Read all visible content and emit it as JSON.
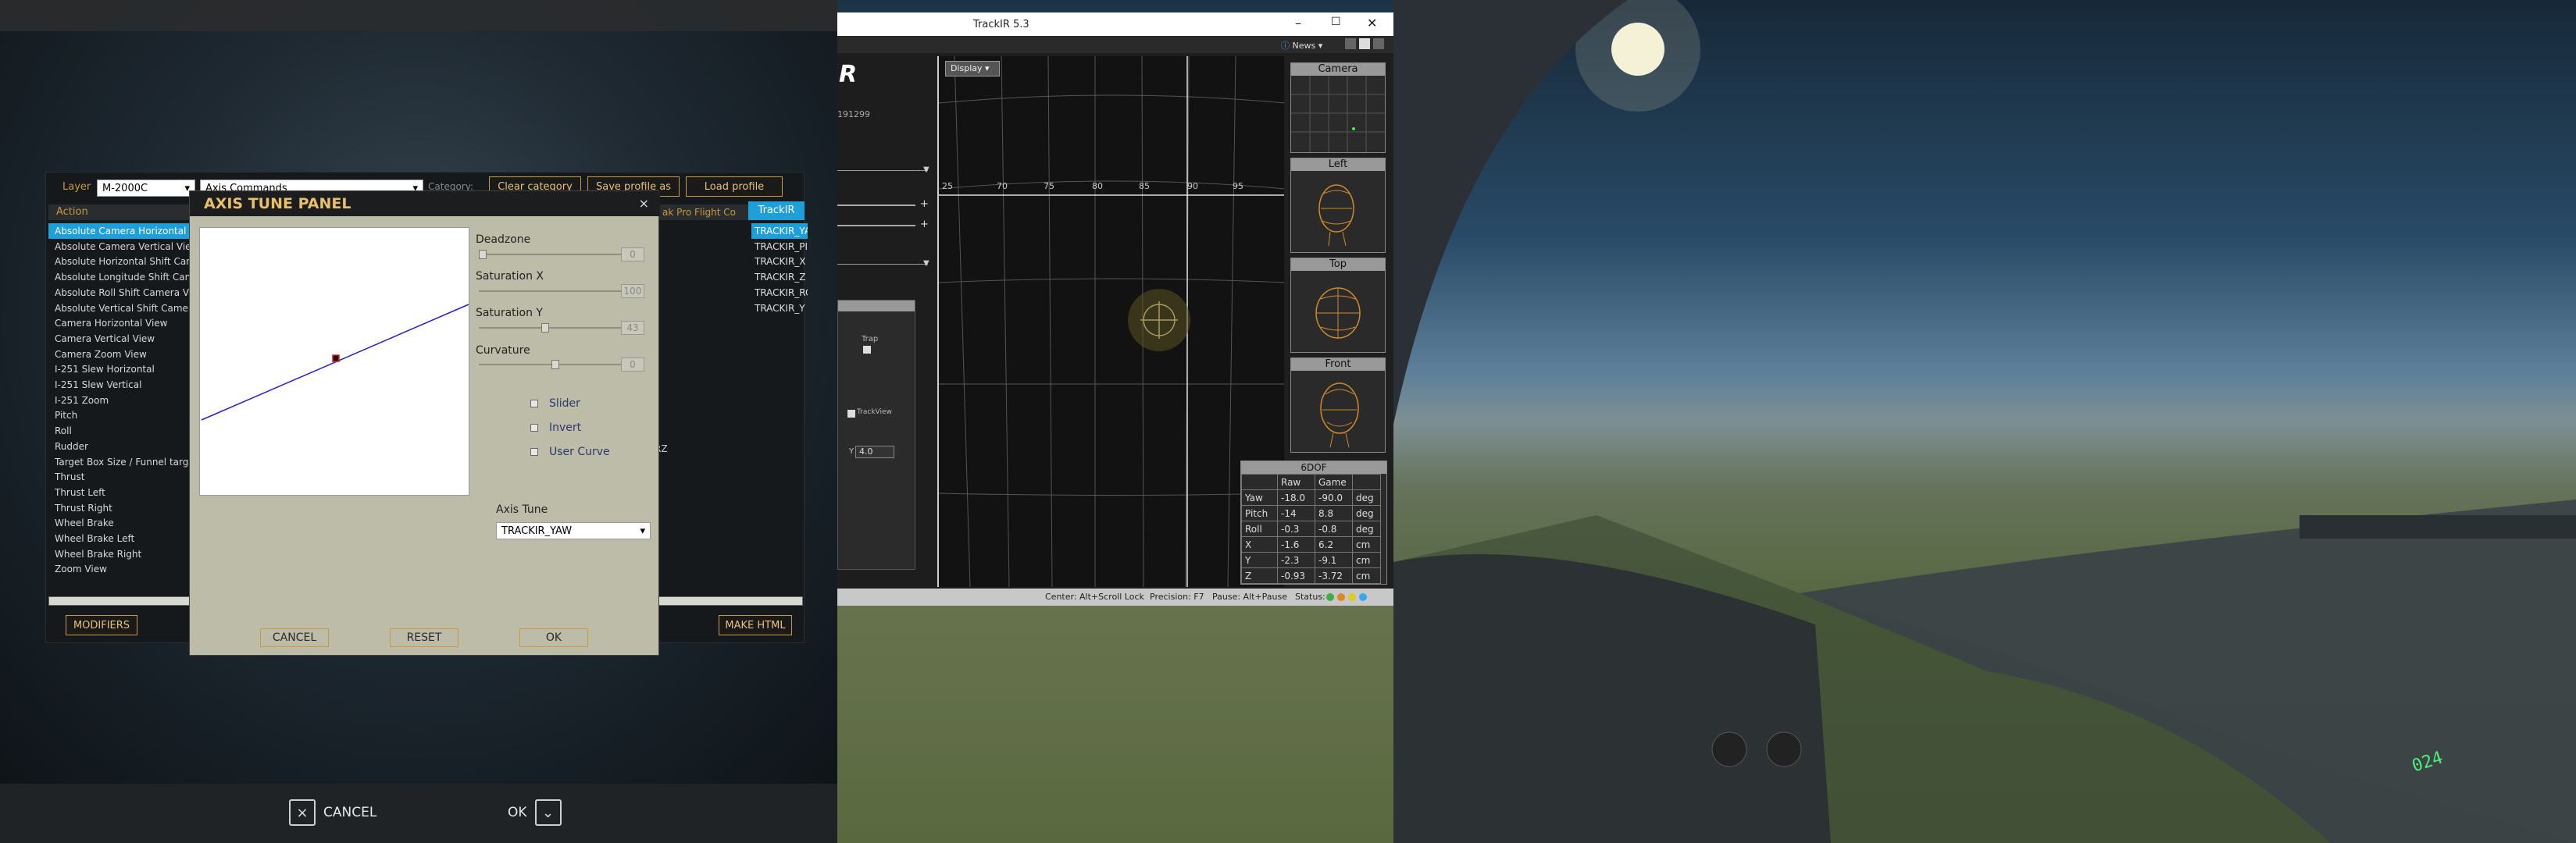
{
  "dcs": {
    "bottom_cancel": "CANCEL",
    "bottom_ok": "OK",
    "layer_label": "Layer",
    "layer_value": "M-2000C",
    "category_value": "Axis Commands",
    "category_label": "Category:",
    "clear_category": "Clear category",
    "save_profile": "Save profile as",
    "load_profile": "Load profile",
    "col_action": "Action",
    "col_device": "ak Pro Flight Co",
    "col_trackir": "TrackIR",
    "actions": [
      "Absolute Camera Horizontal View",
      "Absolute Camera Vertical View",
      "Absolute Horizontal Shift Camera View",
      "Absolute Longitude Shift Camera View",
      "Absolute Roll Shift Camera View",
      "Absolute Vertical Shift Camera View",
      "Camera Horizontal View",
      "Camera Vertical View",
      "Camera Zoom View",
      "I-251 Slew Horizontal",
      "I-251 Slew Vertical",
      "I-251 Zoom",
      "Pitch",
      "Roll",
      "Rudder",
      "Target Box Size / Funnel target wingspan",
      "Thrust",
      "Thrust Left",
      "Thrust Right",
      "Wheel Brake",
      "Wheel Brake Left",
      "Wheel Brake Right",
      "Zoom View"
    ],
    "trackir_bindings": [
      "TRACKIR_YA",
      "TRACKIR_PI",
      "TRACKIR_X",
      "TRACKIR_Z",
      "TRACKIR_RC",
      "TRACKIR_Y"
    ],
    "rz_label": "RZ",
    "modifiers": "MODIFIERS",
    "make_html": "MAKE HTML"
  },
  "axis_panel": {
    "title": "AXIS TUNE PANEL",
    "close": "×",
    "deadzone_label": "Deadzone",
    "deadzone_value": "0",
    "deadzone_level": 0,
    "satx_label": "Saturation X",
    "satx_value": "100",
    "satx_level": 1.0,
    "saty_label": "Saturation Y",
    "saty_value": "43",
    "saty_level": 0.43,
    "curvature_label": "Curvature",
    "curvature_value": "0",
    "curvature_level": 0.5,
    "slider_label": "Slider",
    "invert_label": "Invert",
    "user_curve_label": "User Curve",
    "axis_tune_label": "Axis Tune",
    "axis_tune_value": "TRACKIR_YAW",
    "cancel": "CANCEL",
    "reset": "RESET",
    "ok": "OK"
  },
  "trackir": {
    "title": "TrackIR 5.3",
    "serial": "191299",
    "news": "News",
    "display_button": "Display",
    "axis_ticks": [
      "25",
      "70",
      "75",
      "80",
      "85",
      "90",
      "95"
    ],
    "trap_label": "Trap",
    "trackview_label": "TrackView",
    "y_label": "Y",
    "y_value": "4.0",
    "panels": {
      "camera": "Camera",
      "left": "Left",
      "top": "Top",
      "front": "Front"
    },
    "sixdof": {
      "title": "6DOF",
      "headers": [
        "",
        "Raw",
        "Game",
        ""
      ],
      "rows": [
        [
          "Yaw",
          "-18.0",
          "-90.0",
          "deg"
        ],
        [
          "Pitch",
          "-14",
          "8.8",
          "deg"
        ],
        [
          "Roll",
          "-0.3",
          "-0.8",
          "deg"
        ],
        [
          "X",
          "-1.6",
          "6.2",
          "cm"
        ],
        [
          "Y",
          "-2.3",
          "-9.1",
          "cm"
        ],
        [
          "Z",
          "-0.93",
          "-3.72",
          "cm"
        ]
      ]
    },
    "status": {
      "center": "Center: Alt+Scroll Lock",
      "precision": "Precision: F7",
      "pause": "Pause: Alt+Pause",
      "status": "Status:"
    }
  },
  "sky": {
    "instrument_readout": "024"
  }
}
